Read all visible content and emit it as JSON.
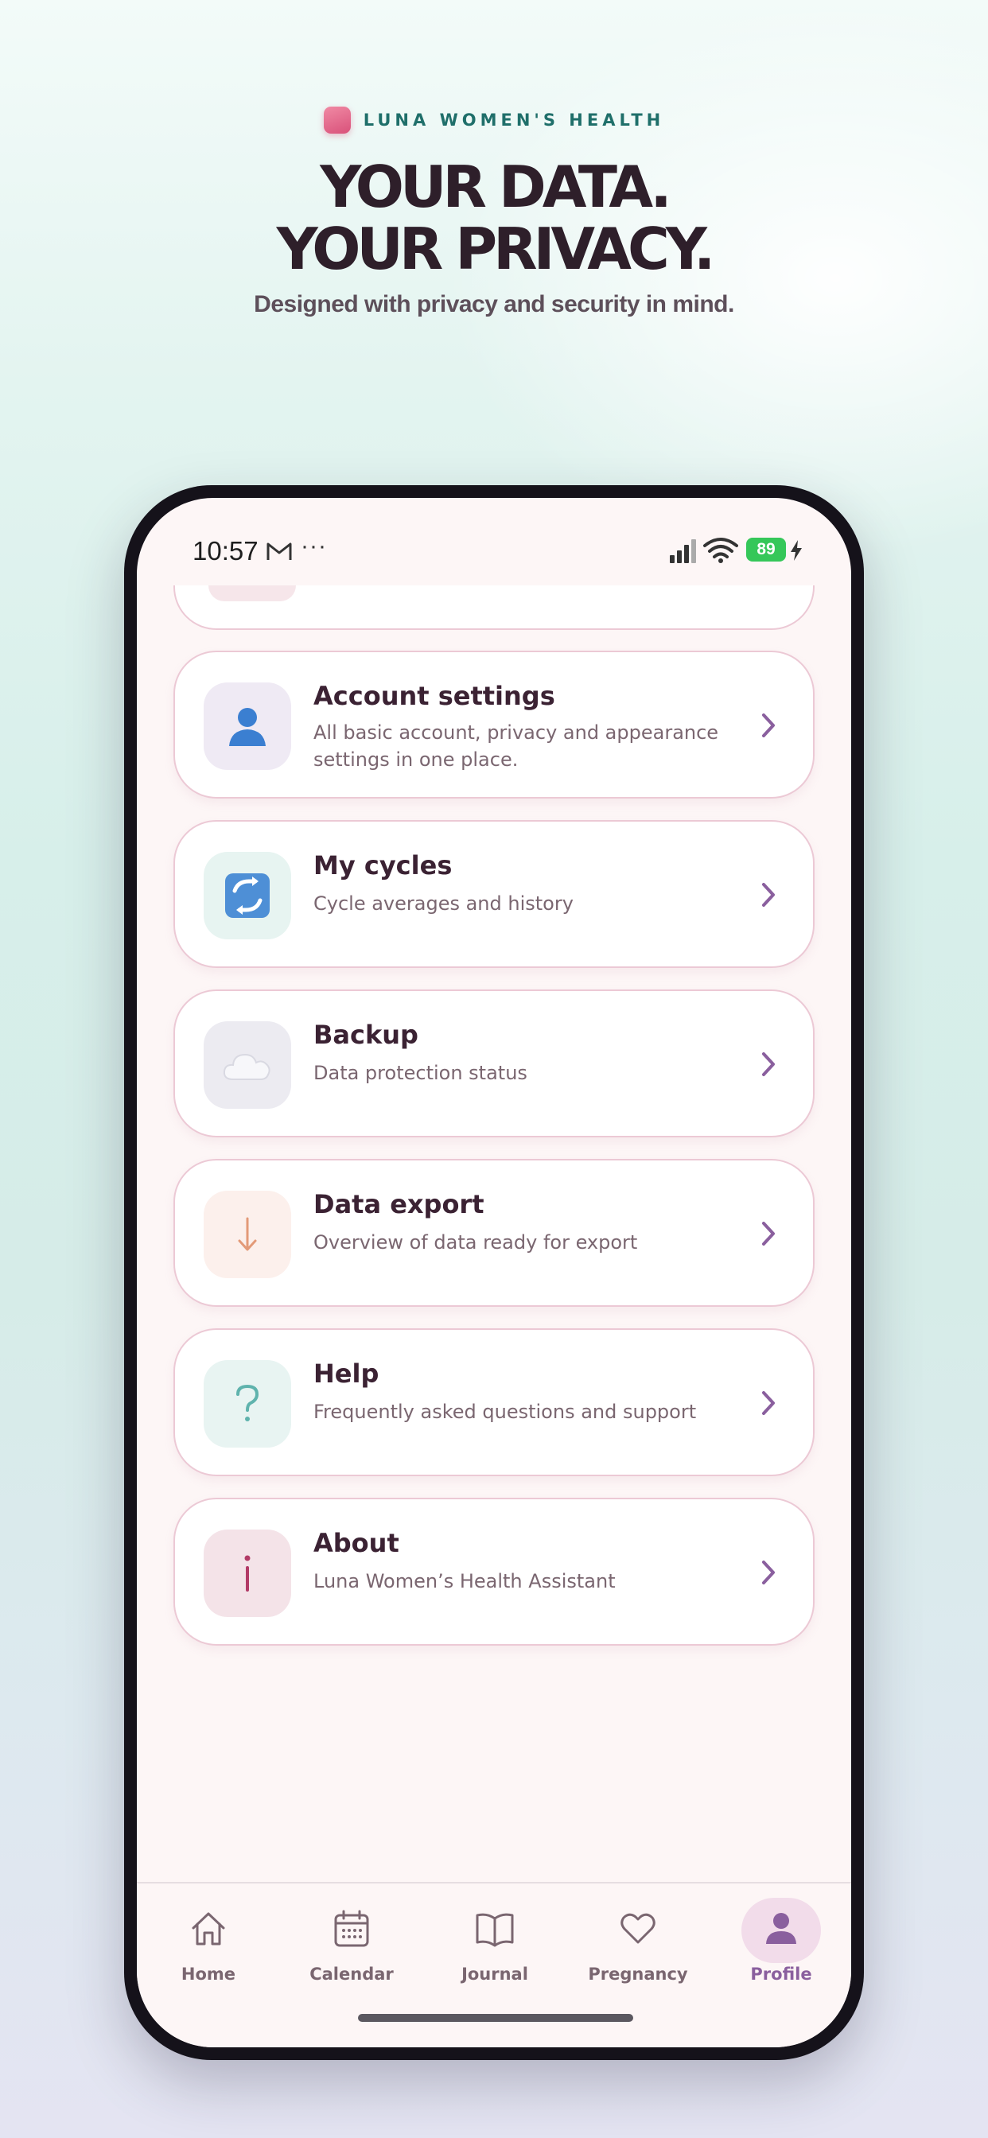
{
  "header": {
    "brand": "LUNA WOMEN'S HEALTH",
    "headline_line1": "YOUR DATA.",
    "headline_line2": "YOUR PRIVACY.",
    "subline": "Designed with privacy and security in mind."
  },
  "status_bar": {
    "time": "10:57",
    "more": "···",
    "battery": "89"
  },
  "menu": [
    {
      "title": "Account settings",
      "subtitle": "All basic account, privacy and appearance settings in one place.",
      "icon": "person-icon",
      "icon_bg": "#efeaf4"
    },
    {
      "title": "My cycles",
      "subtitle": "Cycle averages and history",
      "icon": "cycle-arrows-icon",
      "icon_bg": "#e7f4f1"
    },
    {
      "title": "Backup",
      "subtitle": "Data protection status",
      "icon": "cloud-icon",
      "icon_bg": "#ecebf1"
    },
    {
      "title": "Data export",
      "subtitle": "Overview of data ready for export",
      "icon": "arrow-down-icon",
      "icon_bg": "#fcf0ec"
    },
    {
      "title": "Help",
      "subtitle": "Frequently asked questions and support",
      "icon": "question-icon",
      "icon_bg": "#e8f4f2"
    },
    {
      "title": "About",
      "subtitle": "Luna Women’s Health Assistant",
      "icon": "info-icon",
      "icon_bg": "#f4e3e8"
    }
  ],
  "nav": {
    "items": [
      {
        "label": "Home",
        "icon": "home-icon"
      },
      {
        "label": "Calendar",
        "icon": "calendar-icon"
      },
      {
        "label": "Journal",
        "icon": "book-icon"
      },
      {
        "label": "Pregnancy",
        "icon": "heart-icon"
      },
      {
        "label": "Profile",
        "icon": "profile-icon",
        "active": true
      }
    ]
  },
  "colors": {
    "accent": "#8a5f9e",
    "brand_teal": "#1f6f6a",
    "headline": "#2e1f2a",
    "battery_green": "#35c759"
  }
}
